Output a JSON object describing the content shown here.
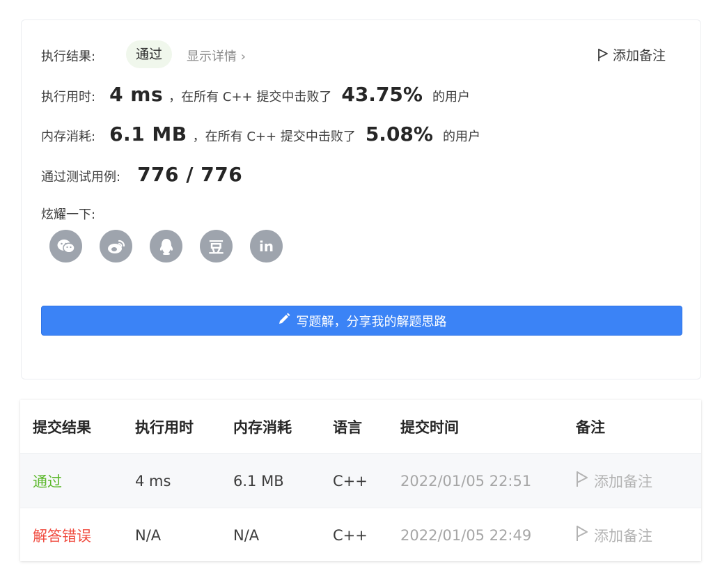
{
  "result": {
    "label": "执行结果:",
    "status": "通过",
    "details_link": "显示详情 ›",
    "add_note": "添加备注"
  },
  "runtime": {
    "label": "执行用时:",
    "value": "4 ms",
    "mid_text": "，在所有 C++ 提交中击败了",
    "percent": "43.75%",
    "suffix": "的用户"
  },
  "memory": {
    "label": "内存消耗:",
    "value": "6.1 MB",
    "mid_text": "，在所有 C++ 提交中击败了",
    "percent": "5.08%",
    "suffix": "的用户"
  },
  "testcases": {
    "label": "通过测试用例:",
    "value": "776 / 776"
  },
  "share": {
    "label": "炫耀一下:",
    "icons": [
      "wechat-icon",
      "weibo-icon",
      "qq-icon",
      "douban-icon",
      "linkedin-icon"
    ],
    "douban_glyph": "豆",
    "linkedin_glyph": "in"
  },
  "write_solution_button": "写题解，分享我的解题思路",
  "submissions": {
    "headers": [
      "提交结果",
      "执行用时",
      "内存消耗",
      "语言",
      "提交时间",
      "备注"
    ],
    "rows": [
      {
        "result": "通过",
        "runtime": "4 ms",
        "memory": "6.1 MB",
        "language": "C++",
        "time": "2022/01/05 22:51",
        "note": "添加备注"
      },
      {
        "result": "解答错误",
        "runtime": "N/A",
        "memory": "N/A",
        "language": "C++",
        "time": "2022/01/05 22:49",
        "note": "添加备注"
      }
    ]
  },
  "colors": {
    "accent_blue": "#3b83f6",
    "success_green": "#5cb82c",
    "error_red": "#f04b3f",
    "icon_gray": "#9ea4ad"
  }
}
